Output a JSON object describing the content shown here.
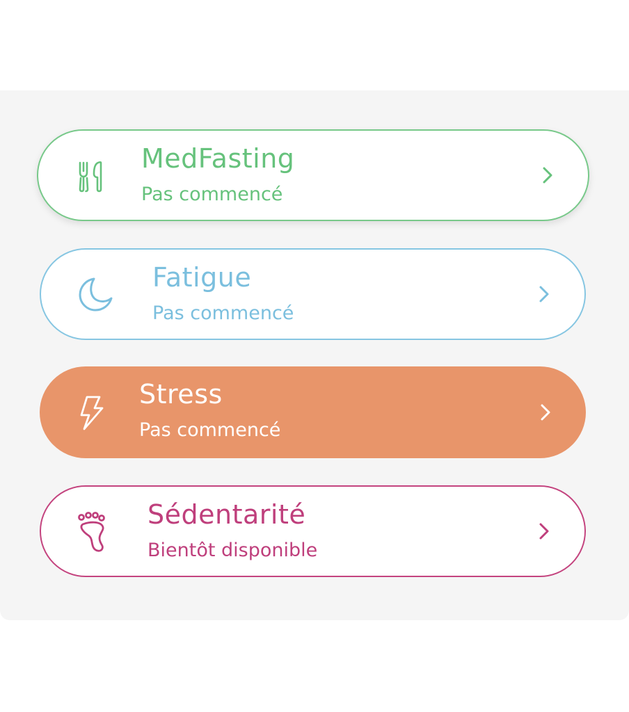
{
  "cards": [
    {
      "id": "medfasting",
      "title": "MedFasting",
      "subtitle": "Pas commencé",
      "icon": "fork-knife-icon",
      "color": "#66c27c",
      "style": "outlined"
    },
    {
      "id": "fatigue",
      "title": "Fatigue",
      "subtitle": "Pas commencé",
      "icon": "moon-icon",
      "color": "#7bbfde",
      "style": "outlined"
    },
    {
      "id": "stress",
      "title": "Stress",
      "subtitle": "Pas commencé",
      "icon": "lightning-icon",
      "color": "#e8956a",
      "style": "filled"
    },
    {
      "id": "sedentarite",
      "title": "Sédentarité",
      "subtitle": "Bientôt disponible",
      "icon": "footprint-icon",
      "color": "#bf3f7c",
      "style": "outlined"
    }
  ],
  "chevron_icon": "chevron-right-icon"
}
